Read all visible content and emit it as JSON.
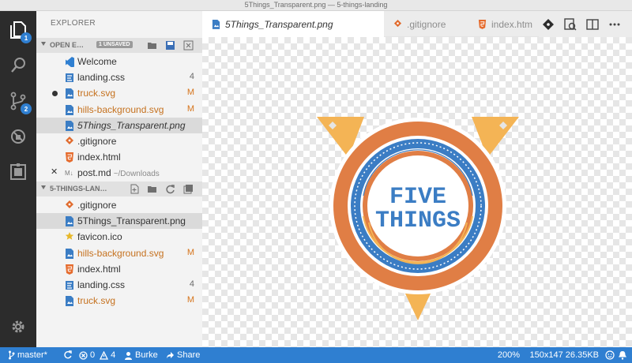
{
  "window": {
    "title": "5Things_Transparent.png — 5-things-landing"
  },
  "activity_bar": {
    "explorer_badge": "1",
    "scm_badge": "2"
  },
  "sidebar": {
    "title": "EXPLORER",
    "open_editors": {
      "label": "OPEN E…",
      "badge": "1 UNSAVED",
      "items": [
        {
          "name": "Welcome",
          "status": "",
          "icon": "vscode-icon",
          "italic": false,
          "modified": false,
          "selected": false,
          "lead": ""
        },
        {
          "name": "landing.css",
          "status": "4",
          "icon": "css-file-icon",
          "italic": false,
          "modified": false,
          "selected": false,
          "lead": ""
        },
        {
          "name": "truck.svg",
          "status": "M",
          "icon": "image-file-icon",
          "italic": false,
          "modified": true,
          "selected": false,
          "lead": "dot"
        },
        {
          "name": "hills-background.svg",
          "status": "M",
          "icon": "image-file-icon",
          "italic": false,
          "modified": true,
          "selected": false,
          "lead": ""
        },
        {
          "name": "5Things_Transparent.png",
          "status": "",
          "icon": "image-file-icon",
          "italic": true,
          "modified": false,
          "selected": true,
          "lead": ""
        },
        {
          "name": ".gitignore",
          "status": "",
          "icon": "git-file-icon",
          "italic": false,
          "modified": false,
          "selected": false,
          "lead": ""
        },
        {
          "name": "index.html",
          "status": "",
          "icon": "html-file-icon",
          "italic": false,
          "modified": false,
          "selected": false,
          "lead": ""
        },
        {
          "name": "post.md",
          "dir": "~/Downloads",
          "status": "",
          "icon": "markdown-file-icon",
          "italic": false,
          "modified": false,
          "selected": false,
          "lead": "close"
        }
      ]
    },
    "folder": {
      "label": "5-THINGS-LAN…",
      "items": [
        {
          "name": ".gitignore",
          "status": "",
          "icon": "git-file-icon",
          "modified": false,
          "selected": false
        },
        {
          "name": "5Things_Transparent.png",
          "status": "",
          "icon": "image-file-icon",
          "modified": false,
          "selected": true
        },
        {
          "name": "favicon.ico",
          "status": "",
          "icon": "star-file-icon",
          "modified": false,
          "selected": false
        },
        {
          "name": "hills-background.svg",
          "status": "M",
          "icon": "image-file-icon",
          "modified": true,
          "selected": false
        },
        {
          "name": "index.html",
          "status": "",
          "icon": "html-file-icon",
          "modified": false,
          "selected": false
        },
        {
          "name": "landing.css",
          "status": "4",
          "icon": "css-file-icon",
          "modified": false,
          "selected": false
        },
        {
          "name": "truck.svg",
          "status": "M",
          "icon": "image-file-icon",
          "modified": true,
          "selected": false
        }
      ]
    }
  },
  "tabs": [
    {
      "label": "5Things_Transparent.png",
      "icon": "image-file-icon",
      "active": true
    },
    {
      "label": ".gitignore",
      "icon": "git-file-icon",
      "active": false
    },
    {
      "label": "index.htm",
      "icon": "html-file-icon",
      "active": false
    }
  ],
  "editor": {
    "logo_text": {
      "line1": "FIVE",
      "line2": "THINGS"
    }
  },
  "status_bar": {
    "branch": "master*",
    "errors": "0",
    "warnings": "4",
    "user": "Burke",
    "share": "Share",
    "zoom": "200%",
    "image_info": "150x147 26.35KB"
  },
  "colors": {
    "status_bar": "#2f7fd1",
    "activity_bar": "#2c2c2c",
    "modified": "#d6741b",
    "logo_orange": "#e07e45",
    "logo_blue": "#3b7dc4",
    "logo_yellow": "#f4b455"
  }
}
